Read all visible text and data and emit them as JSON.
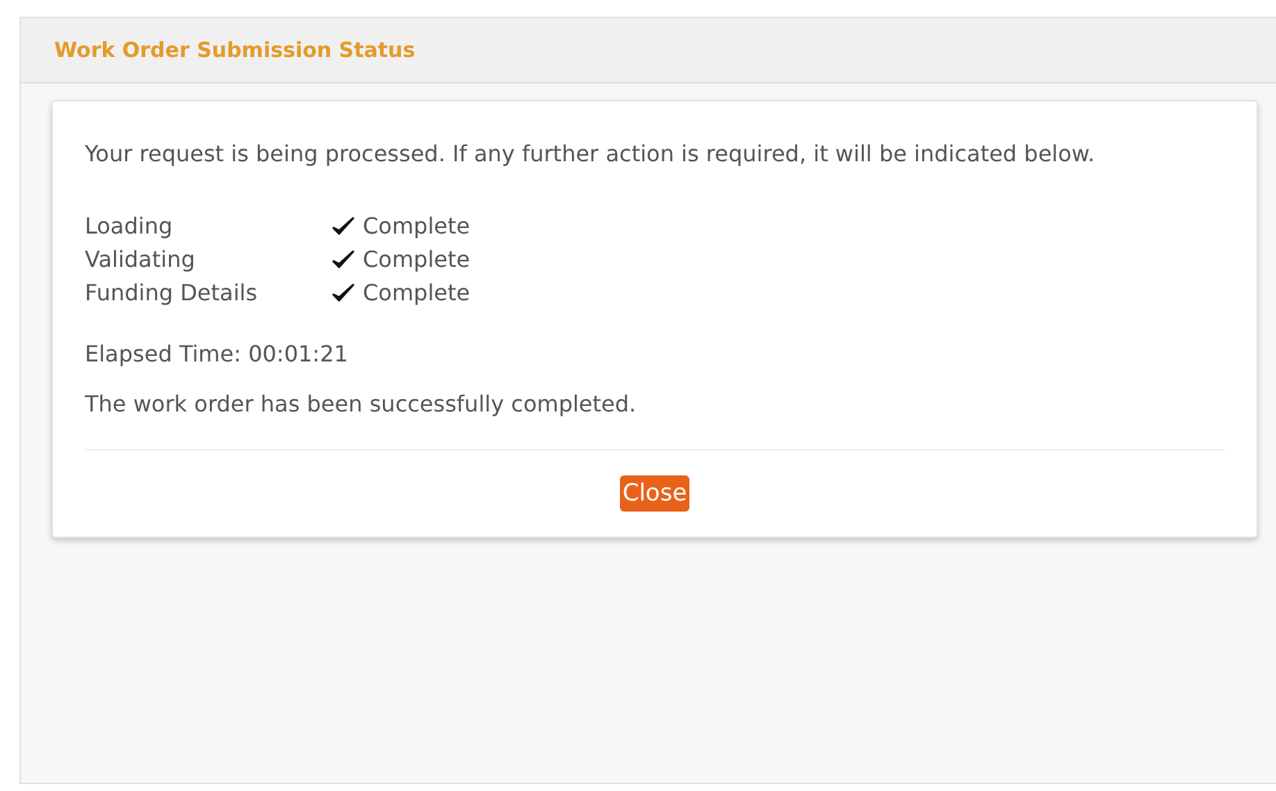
{
  "dialog": {
    "title": "Work Order Submission Status"
  },
  "message": "Your request is being processed. If any further action is required, it will be indicated below.",
  "steps": [
    {
      "label": "Loading",
      "checked": true,
      "status": "Complete"
    },
    {
      "label": "Validating",
      "checked": true,
      "status": "Complete"
    },
    {
      "label": "Funding Details",
      "checked": true,
      "status": "Complete"
    }
  ],
  "elapsed": "Elapsed Time: 00:01:21",
  "result": "The work order has been successfully completed.",
  "buttons": [
    "Close"
  ]
}
